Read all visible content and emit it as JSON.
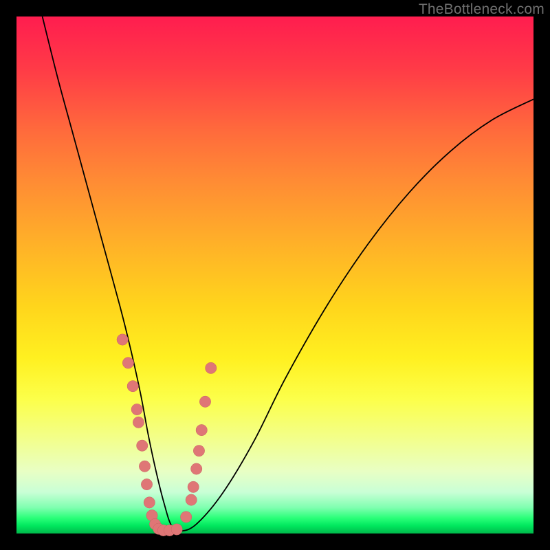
{
  "watermark": "TheBottleneck.com",
  "chart_data": {
    "type": "line",
    "title": "",
    "xlabel": "",
    "ylabel": "",
    "xlim": [
      0,
      100
    ],
    "ylim": [
      0,
      100
    ],
    "grid": false,
    "note": "V-shaped bottleneck curve over a green-to-red gradient. X is a normalized hardware balance axis; Y is bottleneck severity (0 = green/good, 100 = red/bad). Values estimated from pixel positions.",
    "series": [
      {
        "name": "bottleneck_curve",
        "x": [
          5,
          8,
          11,
          14,
          17,
          20,
          22,
          24,
          25.5,
          27,
          28.5,
          30,
          32,
          35,
          40,
          46,
          52,
          60,
          68,
          76,
          84,
          92,
          100
        ],
        "y": [
          100,
          88,
          77,
          66,
          55,
          44,
          36,
          27,
          19,
          12,
          6,
          1.5,
          0.5,
          2,
          8,
          18,
          30,
          44,
          56,
          66,
          74,
          80,
          84
        ]
      }
    ],
    "markers": {
      "name": "highlight_dots",
      "note": "Salmon dots near the minimum emphasising the optimal range",
      "x": [
        20.5,
        21.6,
        22.5,
        23.3,
        23.6,
        24.3,
        24.8,
        25.2,
        25.7,
        26.2,
        26.8,
        27.5,
        28.4,
        29.6,
        31.0,
        32.8,
        33.8,
        34.2,
        34.8,
        35.3,
        35.8,
        36.5,
        37.6
      ],
      "y": [
        37.5,
        33.0,
        28.5,
        24.0,
        21.5,
        17.0,
        13.0,
        9.5,
        6.0,
        3.5,
        1.8,
        0.9,
        0.6,
        0.6,
        0.8,
        3.2,
        6.5,
        9.0,
        12.5,
        16.0,
        20.0,
        25.5,
        32.0
      ]
    },
    "gradient_stops": [
      {
        "pos": 0.0,
        "color": "#ff1d4f"
      },
      {
        "pos": 0.22,
        "color": "#ff6a3c"
      },
      {
        "pos": 0.56,
        "color": "#ffd51c"
      },
      {
        "pos": 0.82,
        "color": "#f2ff8e"
      },
      {
        "pos": 0.97,
        "color": "#2bff79"
      },
      {
        "pos": 1.0,
        "color": "#00b84a"
      }
    ]
  }
}
